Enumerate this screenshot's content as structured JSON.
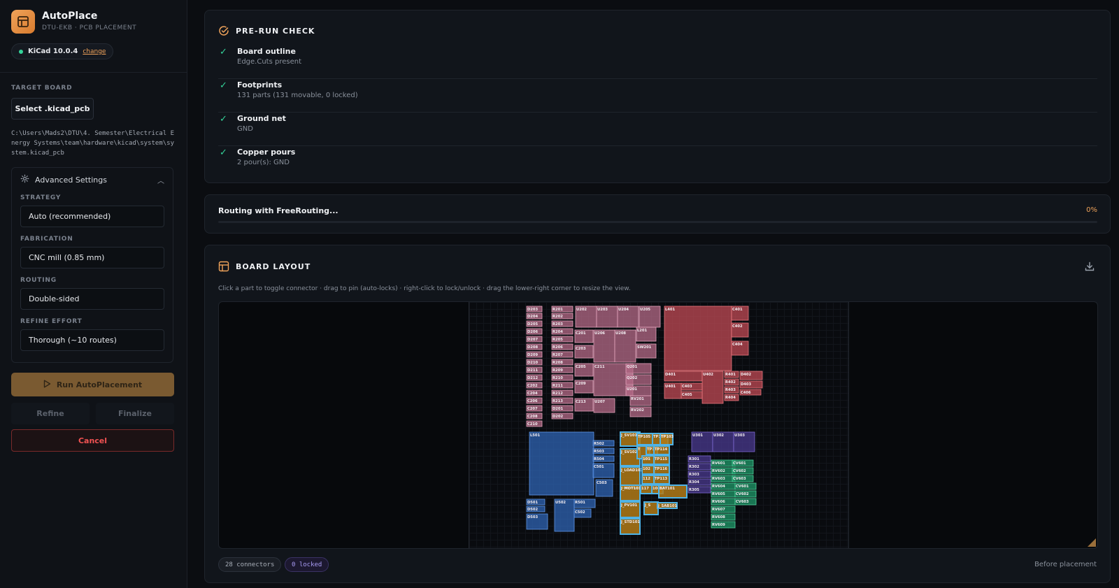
{
  "app": {
    "name": "AutoPlace",
    "subtitle": "DTU-EKB · PCB PLACEMENT",
    "kicad_version": "KiCad 10.0.4",
    "change_label": "change"
  },
  "sidebar": {
    "target_label": "TARGET BOARD",
    "select_button": "Select .kicad_pcb",
    "board_path": "C:\\Users\\Mads2\\DTU\\4. Semester\\Electrical Energy Systems\\team\\hardware\\kicad\\system\\system.kicad_pcb",
    "advanced": {
      "title": "Advanced Settings",
      "strategy_label": "STRATEGY",
      "strategy_value": "Auto (recommended)",
      "fabrication_label": "FABRICATION",
      "fabrication_value": "CNC mill (0.85 mm)",
      "routing_label": "ROUTING",
      "routing_value": "Double-sided",
      "refine_label": "REFINE EFFORT",
      "refine_value": "Thorough (~10 routes)"
    },
    "run_button": "Run AutoPlacement",
    "refine_button": "Refine",
    "finalize_button": "Finalize",
    "cancel_button": "Cancel"
  },
  "precheck": {
    "title": "PRE-RUN CHECK",
    "items": [
      {
        "name": "Board outline",
        "desc": "Edge.Cuts present"
      },
      {
        "name": "Footprints",
        "desc": "131 parts (131 movable, 0 locked)"
      },
      {
        "name": "Ground net",
        "desc": "GND"
      },
      {
        "name": "Copper pours",
        "desc": "2 pour(s): GND"
      }
    ]
  },
  "routing": {
    "status": "Routing with FreeRouting...",
    "percent_label": "0%",
    "progress": 0.0
  },
  "board_layout": {
    "title": "BOARD LAYOUT",
    "hint": "Click a part to toggle connector · drag to pin (auto-locks) · right-click to lock/unlock · drag the lower-right corner to resize the view.",
    "connectors_pill": "28 connectors",
    "locked_pill": "0 locked",
    "state": "Before placement",
    "colors": {
      "power_pink": "#b66b88",
      "analog_red": "#c24b55",
      "blue_group": "#2f64b4",
      "connector_gold": "#b07a16",
      "connector_outline": "#4fb3e6",
      "purple_group": "#4a3a8f",
      "green_group": "#1f9a6a"
    },
    "labels": {
      "d203": "D203",
      "d204": "D204",
      "d205": "D205",
      "d206": "D206",
      "d207": "D207",
      "d208": "D208",
      "d209": "D209",
      "d210": "D210",
      "d211": "D211",
      "d212": "D212",
      "c202": "C202",
      "c204": "C204",
      "c206": "C206",
      "c207": "C207",
      "c208": "C208",
      "c210": "C210",
      "r201": "R201",
      "r202": "R202",
      "r203": "R203",
      "r204": "R204",
      "r205": "R205",
      "r206": "R206",
      "r207": "R207",
      "r208": "R208",
      "r209": "R209",
      "r210": "R210",
      "r211": "R211",
      "r212": "R212",
      "r213": "R213",
      "d201": "D201",
      "d202": "D202",
      "u202": "U202",
      "u203": "U203",
      "u204": "U204",
      "u205": "U205",
      "c201": "C201",
      "u206": "U206",
      "u208": "U208",
      "l201": "L201",
      "c203": "C203",
      "sw201": "SW201",
      "c205": "C205",
      "c211": "C211",
      "q201": "Q201",
      "q202": "Q202",
      "c209": "C209",
      "u201": "U201",
      "c213": "C213",
      "u207": "U207",
      "rv201": "RV201",
      "rv202": "RV202",
      "l401": "L401",
      "c401": "C401",
      "c402": "C402",
      "c404": "C404",
      "d401": "D401",
      "u402": "U402",
      "r401": "R401",
      "r402": "R402",
      "r403": "R403",
      "r404": "R404",
      "c403": "C403",
      "c405": "C405",
      "u401": "U401",
      "d402": "D402",
      "d403": "D403",
      "c406": "C406",
      "c407": "C407",
      "l501": "L501",
      "r502": "R502",
      "r503": "R503",
      "r504": "R504",
      "c501": "C501",
      "c503": "C503",
      "d501": "D501",
      "d502": "D502",
      "d503": "D503",
      "u502": "U502",
      "r501": "R501",
      "c502": "C502",
      "r505": "R505",
      "j_sv101": "J_SV101",
      "j_sv102": "J_SV102",
      "j_load101": "J_LOAD101",
      "j_mot101": "J_MOT101",
      "j_pv101": "J_PV101",
      "j_std101": "J_STD101",
      "j_sab101": "J_SAB101",
      "j_tp105": "TP105",
      "j_tp107": "TP107",
      "j_tp103": "TP103",
      "tp": "T",
      "tp101": "101",
      "tp102": "102",
      "tp111": "TP111",
      "tp112": "112",
      "tp113": "TP113",
      "tp114": "TP114",
      "tp115": "TP115",
      "tp116": "TP116",
      "tp117": "117",
      "tp108": "108",
      "j_sa": "J_S",
      "j_bat": "BAT101",
      "u301": "U301",
      "u302": "U302",
      "u303": "U303",
      "r301": "R301",
      "r302": "R302",
      "r303": "R303",
      "r304": "R304",
      "r305": "R305",
      "rv601": "RV601",
      "rv602": "RV602",
      "rv603": "RV603",
      "rv604": "RV604",
      "rv605": "RV605",
      "rv606": "RV606",
      "rv607": "RV607",
      "rv608": "RV608",
      "rv609": "RV609",
      "cv601": "CV601",
      "cv602": "CV602",
      "cv603": "CV603",
      "cv604": "CV601",
      "cv605": "CV602",
      "cv606": "CV603"
    }
  }
}
